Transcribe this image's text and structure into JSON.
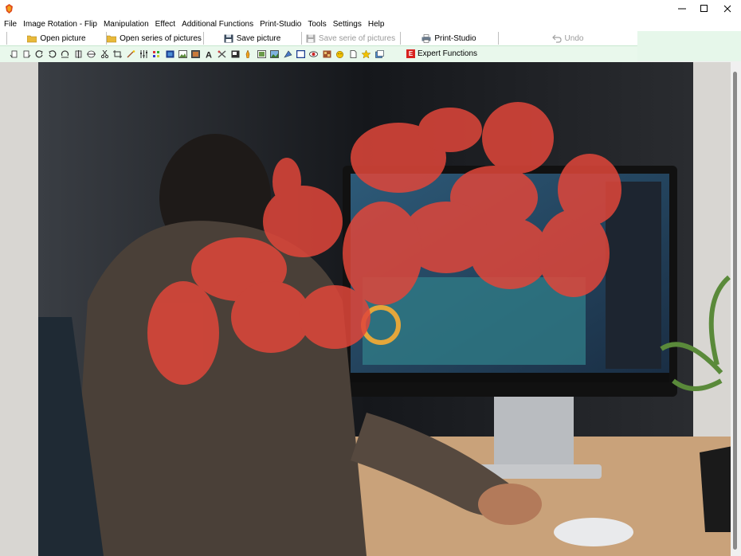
{
  "window": {
    "controls": {
      "minimize": "minimize-icon",
      "maximize": "maximize-icon",
      "close": "close-icon"
    }
  },
  "menu": [
    "File",
    "Image Rotation - Flip",
    "Manipulation",
    "Effect",
    "Additional Functions",
    "Print-Studio",
    "Tools",
    "Settings",
    "Help"
  ],
  "toolbar": {
    "open_picture": "Open picture",
    "open_series": "Open series of pictures",
    "save_picture": "Save picture",
    "save_series": "Save serie of pictures",
    "print_studio": "Print-Studio",
    "undo": "Undo"
  },
  "tools": {
    "expert_badge": "E",
    "expert_label": "Expert Functions"
  },
  "colors": {
    "accent_green": "#e9f8ec",
    "expert_red": "#d8221f",
    "folder_yellow": "#e8b93a"
  }
}
